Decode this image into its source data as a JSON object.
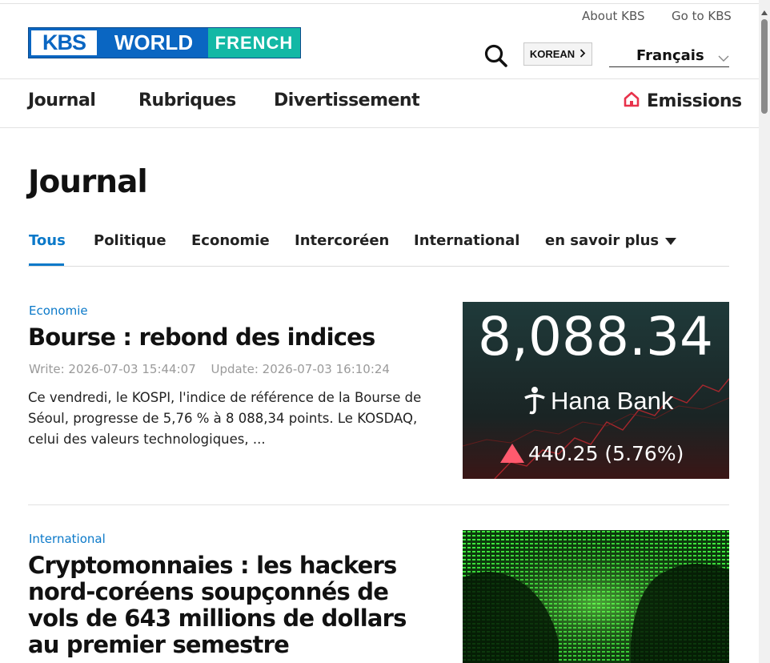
{
  "header": {
    "util_links": [
      "About KBS",
      "Go to KBS"
    ],
    "logo": {
      "kbs": "KBS",
      "world": "WORLD",
      "lang": "FRENCH"
    },
    "korean_button": "KOREAN",
    "language_select": "Français"
  },
  "gnb": {
    "items": [
      "Journal",
      "Rubriques",
      "Divertissement"
    ],
    "emissions": "Emissions"
  },
  "page": {
    "title": "Journal",
    "tabs": [
      "Tous",
      "Politique",
      "Economie",
      "Intercoréen",
      "International"
    ],
    "active_tab": "Tous",
    "more_tab": "en savoir plus"
  },
  "articles": [
    {
      "category": "Economie",
      "title": "Bourse : rebond des indices",
      "write": "Write: 2026-07-03 15:44:07",
      "update": "Update: 2026-07-03 16:10:24",
      "summary": "Ce vendredi, le KOSPI, l'indice de référence de la Bourse de Séoul, progresse de 5,76 % à 8 088,34 points. Le KOSDAQ, celui des valeurs technologiques, ...",
      "image": {
        "index": "8,088.34",
        "sponsor": "Hana Bank",
        "change": "440.25 (5.76%)"
      }
    },
    {
      "category": "International",
      "title": "Cryptomonnaies : les hackers nord-coréens soupçonnés de vols de 643 millions de dollars au premier semestre"
    }
  ],
  "colors": {
    "accent": "#0b79c9",
    "brand_blue": "#0a66c2",
    "brand_teal": "#13b8a5",
    "up_red": "#ff5a6e"
  }
}
